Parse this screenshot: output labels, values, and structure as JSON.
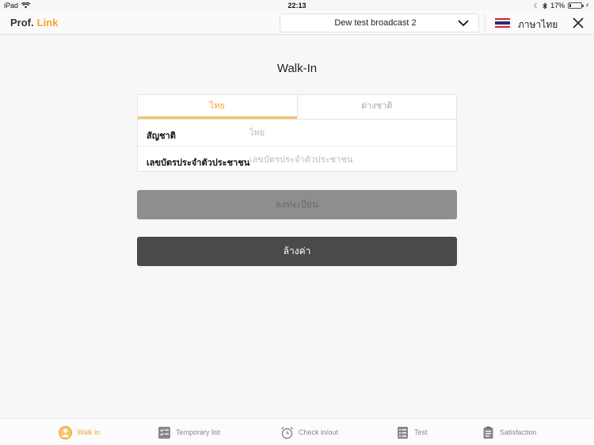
{
  "status": {
    "device": "iPad",
    "time": "22:13",
    "battery": "17%",
    "battery_level": 0.17
  },
  "header": {
    "logo_part1": "Prof.",
    "logo_part2": "Link",
    "broadcast": "Dew test broadcast 2",
    "language": "ภาษาไทย"
  },
  "main": {
    "title": "Walk-In",
    "tabs": [
      {
        "label": "ไทย",
        "active": true
      },
      {
        "label": "ต่างชาติ",
        "active": false
      }
    ],
    "fields": {
      "nationality_label": "สัญชาติ",
      "nationality_placeholder": "ไทย",
      "id_label": "เลขบัตรประจำตัวประชาชน",
      "id_placeholder": "เลขบัตรประจำตัวประชาชน"
    },
    "register_button": "ลงทะเบียน",
    "clear_button": "ล้างค่า"
  },
  "tabbar": {
    "items": [
      {
        "label": "Walk in",
        "icon": "walk-in-icon",
        "active": true
      },
      {
        "label": "Temporary list",
        "icon": "temporary-list-icon",
        "active": false
      },
      {
        "label": "Check in/out",
        "icon": "alarm-clock-icon",
        "active": false
      },
      {
        "label": "Test",
        "icon": "test-list-icon",
        "active": false
      },
      {
        "label": "Satisfaction",
        "icon": "clipboard-icon",
        "active": false
      }
    ]
  },
  "colors": {
    "accent": "#f2a52c",
    "register_bg": "#8d8e8e",
    "clear_bg": "#4a4a4a"
  }
}
